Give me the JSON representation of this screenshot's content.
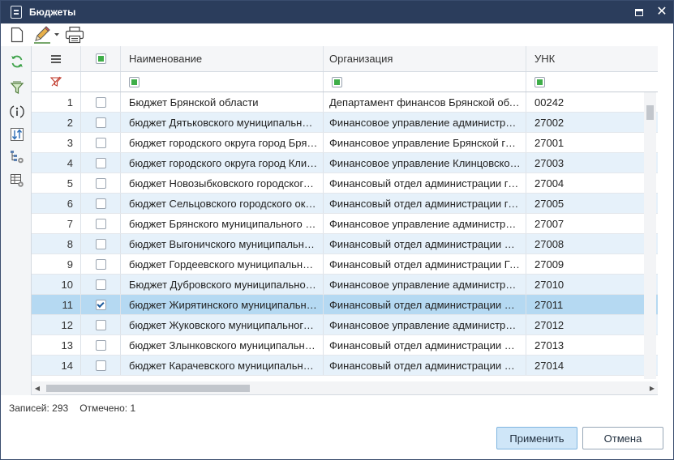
{
  "window": {
    "title": "Бюджеты",
    "maximize_icon": "maximize-icon",
    "close_label": "✕"
  },
  "toolbar": {
    "icons": [
      "new-document-icon",
      "edit-pencil-icon",
      "dropdown-arrow-icon",
      "print-icon"
    ]
  },
  "side_panel": {
    "icons": [
      "refresh-icon",
      "filter-icon",
      "info-icon",
      "sort-icon",
      "tree-settings-icon",
      "grid-settings-icon"
    ]
  },
  "grid": {
    "columns": [
      "Наименование",
      "Организация",
      "УНК"
    ],
    "rows": [
      {
        "num": "1",
        "name": "Бюджет Брянской области",
        "org": "Департамент финансов Брянской области",
        "unk": "00242",
        "checked": false
      },
      {
        "num": "2",
        "name": "бюджет Дятьковского муниципального района",
        "org": "Финансовое управление администрации Дятьковского района",
        "unk": "27002",
        "checked": false
      },
      {
        "num": "3",
        "name": "бюджет городского округа город Брянск",
        "org": "Финансовое управление Брянской городской администрации",
        "unk": "27001",
        "checked": false
      },
      {
        "num": "4",
        "name": "бюджет городского округа город Клинцы",
        "org": "Финансовое управление Клинцовской городской администрации",
        "unk": "27003",
        "checked": false
      },
      {
        "num": "5",
        "name": "бюджет Новозыбковского городского округа",
        "org": "Финансовый отдел администрации города Новозыбкова",
        "unk": "27004",
        "checked": false
      },
      {
        "num": "6",
        "name": "бюджет Сельцовского городского округа",
        "org": "Финансовый отдел администрации города Сельцо",
        "unk": "27005",
        "checked": false
      },
      {
        "num": "7",
        "name": "бюджет Брянского муниципального района",
        "org": "Финансовое управление администрации Брянского района",
        "unk": "27007",
        "checked": false
      },
      {
        "num": "8",
        "name": "бюджет Выгоничского муниципального района",
        "org": "Финансовый отдел администрации Выгоничского района",
        "unk": "27008",
        "checked": false
      },
      {
        "num": "9",
        "name": "бюджет Гордеевского муниципального района",
        "org": "Финансовый отдел администрации Гордеевского района",
        "unk": "27009",
        "checked": false
      },
      {
        "num": "10",
        "name": "Бюджет Дубровского муниципального района",
        "org": "Финансовое управление администрации Дубровского района",
        "unk": "27010",
        "checked": false
      },
      {
        "num": "11",
        "name": "бюджет Жирятинского муниципального района",
        "org": "Финансовый отдел администрации Жирятинского района",
        "unk": "27011",
        "checked": true
      },
      {
        "num": "12",
        "name": "бюджет Жуковского муниципального округа",
        "org": "Финансовое управление администрации Жуковского округа",
        "unk": "27012",
        "checked": false
      },
      {
        "num": "13",
        "name": "бюджет Злынковского муниципального района",
        "org": "Финансовый отдел администрации Злынковского района",
        "unk": "27013",
        "checked": false
      },
      {
        "num": "14",
        "name": "бюджет Карачевского муниципального района",
        "org": "Финансовый отдел администрации Карачевского района",
        "unk": "27014",
        "checked": false
      }
    ],
    "selected_row": 11
  },
  "status": {
    "records": "Записей: 293",
    "checked": "Отмечено: 1"
  },
  "buttons": {
    "apply": "Применить",
    "cancel": "Отмена"
  }
}
